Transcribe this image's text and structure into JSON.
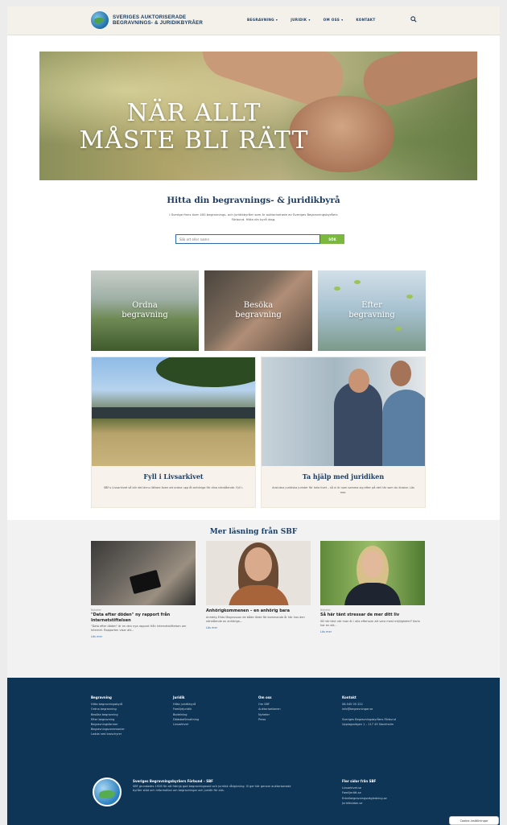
{
  "header": {
    "logo_line1": "SVERIGES AUKTORISERADE",
    "logo_line2": "BEGRAVNINGS- & JURIDIKBYRÅER",
    "nav": [
      "BEGRAVNING",
      "JURIDIK",
      "OM OSS",
      "KONTAKT"
    ]
  },
  "hero": {
    "title_line1": "NÄR ALLT",
    "title_line2": "MÅSTE BLI RÄTT"
  },
  "find": {
    "title": "Hitta din begravnings- & juridikbyrå",
    "text": "I Sverige finns över 400 begravnings- och juridikbyråer som är auktoriserade av Sveriges Begravningsbyråers Förbund. Hitta din byrå idag.",
    "input_placeholder": "Sök ort eller namn",
    "button_label": "SÖK"
  },
  "tiles": [
    {
      "label_line1": "Ordna",
      "label_line2": "begravning"
    },
    {
      "label_line1": "Besöka",
      "label_line2": "begravning"
    },
    {
      "label_line1": "Efter",
      "label_line2": "begravning"
    }
  ],
  "cards": [
    {
      "title": "Fyll i Livsarkivet",
      "text": "SBF:s Livsarkivet så blir det ännu lättare även att ordna upp åt anhöriga för dina närstående. Fyll i."
    },
    {
      "title": "Ta hjälp med juridiken",
      "text": "Anslutna juridiska jurister för hela livet – så ni är som samma sig efter på det här som du önskar. Läs mer."
    }
  ],
  "more": {
    "title": "Mer läsning från SBF",
    "articles": [
      {
        "category": "Nyheter",
        "title": "\"Data efter döden\" ny rapport från Internetstiftelsen",
        "excerpt": "\"Data efter döden\" är en den nya rapport från Internetstiftelsen om Internet. Rapporten visar att...",
        "read_more": "Läs mer"
      },
      {
        "category": "",
        "title": "Anhörigkommenen – en anhörig bara",
        "excerpt": "Anhörig Elida Magnusson de både lärde för kommande år här hos den närstående av anhöriga...",
        "read_more": "Läs mer"
      },
      {
        "category": "Nyheter",
        "title": "Så här tänt stressar de mer ditt liv",
        "excerpt": "Så här tänt när man är i alla eftersom att vara mest möjligheter? Karin har en att...",
        "read_more": "Läs mer"
      }
    ]
  },
  "footer": {
    "columns": [
      {
        "heading": "Begravning",
        "items": [
          "Hitta begravningsbyrå",
          "Ordna begravning",
          "Besöka begravning",
          "Efter begravning",
          "Begravningsformer",
          "Begravningsceremonier",
          "Ladda ned broschyrer"
        ]
      },
      {
        "heading": "Juridik",
        "items": [
          "Hitta juridikbyrå",
          "Familjejuridik",
          "Bodelning",
          "Dödsboförvaltning",
          "Livsarkivet"
        ]
      },
      {
        "heading": "Om oss",
        "items": [
          "Om SBF",
          "Auktorisationen",
          "Nyheter",
          "Press"
        ]
      },
      {
        "heading": "Kontakt",
        "items": [
          "08-545 05 222",
          "info@begravningar.se",
          "",
          "Sveriges Begravningsbyråers Förbund",
          "Upplagsvägen 1 – 117 43 Stockholm"
        ]
      }
    ],
    "org_heading": "Sveriges Begravningsbyråers Förbund – SBF",
    "org_text": "SBF grundades 1926 för att främja god begravningssed och juridisk rådgivning. Vi ger här genom auktoriserade byråer stöd och information om begravningar och juridik för alla.",
    "social_heading": "Fler sidor från SBF",
    "social_items": [
      "Livsarkivet.se",
      "Familjerätt.se",
      "Enkelbegravningsvägledning.se",
      "Juridiksidan.se"
    ],
    "cookie_label": "Cookie-inställningar"
  }
}
